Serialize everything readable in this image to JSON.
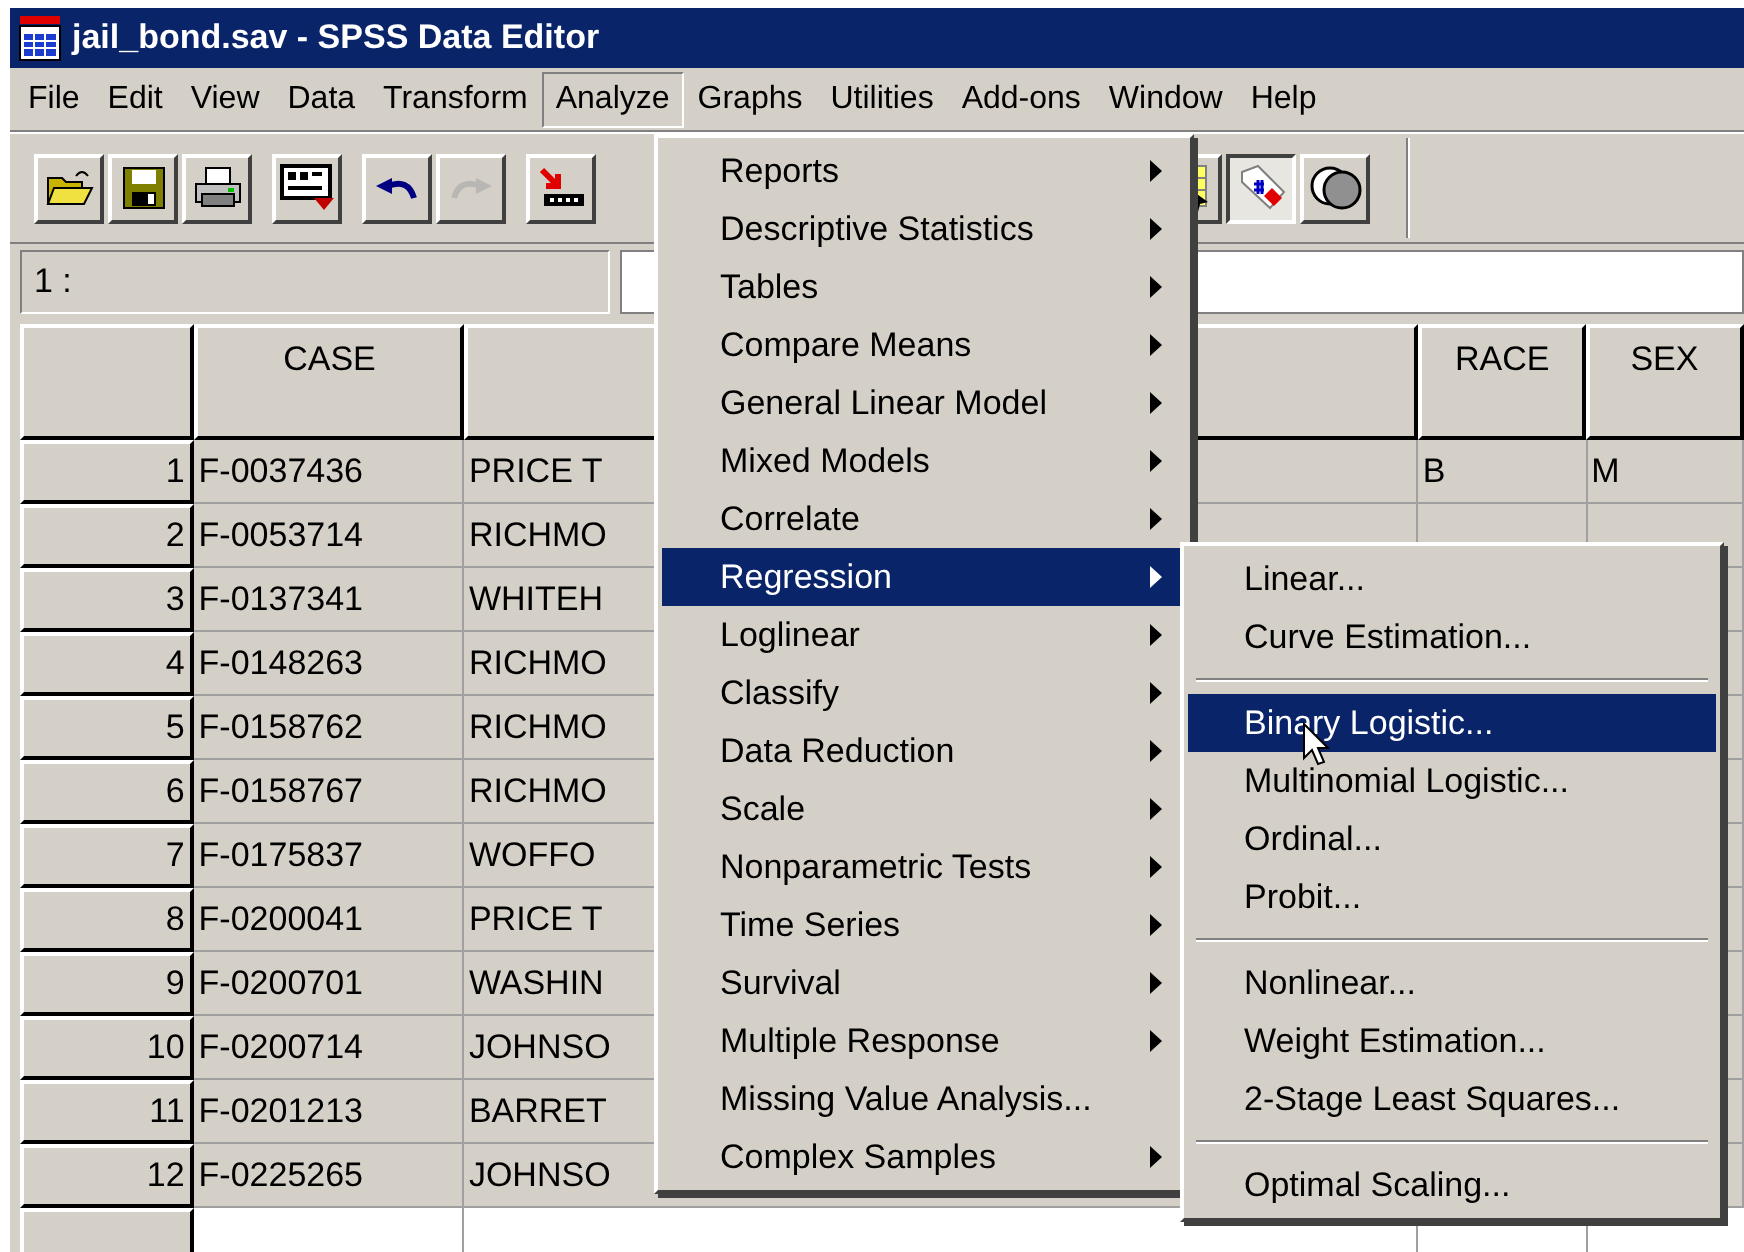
{
  "window": {
    "title": "jail_bond.sav - SPSS Data Editor"
  },
  "menu_bar": [
    {
      "label": "File",
      "selected": false
    },
    {
      "label": "Edit",
      "selected": false
    },
    {
      "label": "View",
      "selected": false
    },
    {
      "label": "Data",
      "selected": false
    },
    {
      "label": "Transform",
      "selected": false
    },
    {
      "label": "Analyze",
      "selected": true
    },
    {
      "label": "Graphs",
      "selected": false
    },
    {
      "label": "Utilities",
      "selected": false
    },
    {
      "label": "Add-ons",
      "selected": false
    },
    {
      "label": "Window",
      "selected": false
    },
    {
      "label": "Help",
      "selected": false
    }
  ],
  "toolbar_left": [
    {
      "kind": "open",
      "disabled": false,
      "pressed": false
    },
    {
      "kind": "save",
      "disabled": false,
      "pressed": false
    },
    {
      "kind": "print",
      "disabled": false,
      "pressed": false
    },
    {
      "kind": "dialog",
      "disabled": false,
      "pressed": false
    },
    {
      "kind": "undo",
      "disabled": false,
      "pressed": false
    },
    {
      "kind": "redo",
      "disabled": true,
      "pressed": false
    },
    {
      "kind": "goto",
      "disabled": false,
      "pressed": false
    }
  ],
  "toolbar_right": [
    {
      "kind": "grid",
      "disabled": false,
      "pressed": false
    },
    {
      "kind": "labels",
      "disabled": false,
      "pressed": true
    },
    {
      "kind": "sets",
      "disabled": false,
      "pressed": false
    }
  ],
  "cell_editor": {
    "cell_ref": "1 :"
  },
  "grid": {
    "columns": {
      "case": "CASE",
      "race": "RACE",
      "sex": "SEX"
    },
    "rows": [
      {
        "number": "1",
        "case": "F-0037436",
        "name": "PRICE T",
        "race": "B",
        "sex": "M"
      },
      {
        "number": "2",
        "case": "F-0053714",
        "name": "RICHMO"
      },
      {
        "number": "3",
        "case": "F-0137341",
        "name": "WHITEH"
      },
      {
        "number": "4",
        "case": "F-0148263",
        "name": "RICHMO"
      },
      {
        "number": "5",
        "case": "F-0158762",
        "name": "RICHMO"
      },
      {
        "number": "6",
        "case": "F-0158767",
        "name": "RICHMO"
      },
      {
        "number": "7",
        "case": "F-0175837",
        "name": "WOFFO"
      },
      {
        "number": "8",
        "case": "F-0200041",
        "name": "PRICE T"
      },
      {
        "number": "9",
        "case": "F-0200701",
        "name": "WASHIN"
      },
      {
        "number": "10",
        "case": "F-0200714",
        "name": "JOHNSO"
      },
      {
        "number": "11",
        "case": "F-0201213",
        "name": "BARRET"
      },
      {
        "number": "12",
        "case": "F-0225265",
        "name": "JOHNSO"
      }
    ]
  },
  "analyze_menu": [
    {
      "label": "Reports",
      "submenu": true,
      "selected": false
    },
    {
      "label": "Descriptive Statistics",
      "submenu": true,
      "selected": false
    },
    {
      "label": "Tables",
      "submenu": true,
      "selected": false
    },
    {
      "label": "Compare Means",
      "submenu": true,
      "selected": false
    },
    {
      "label": "General Linear Model",
      "submenu": true,
      "selected": false
    },
    {
      "label": "Mixed Models",
      "submenu": true,
      "selected": false
    },
    {
      "label": "Correlate",
      "submenu": true,
      "selected": false
    },
    {
      "label": "Regression",
      "submenu": true,
      "selected": true
    },
    {
      "label": "Loglinear",
      "submenu": true,
      "selected": false
    },
    {
      "label": "Classify",
      "submenu": true,
      "selected": false
    },
    {
      "label": "Data Reduction",
      "submenu": true,
      "selected": false
    },
    {
      "label": "Scale",
      "submenu": true,
      "selected": false
    },
    {
      "label": "Nonparametric Tests",
      "submenu": true,
      "selected": false
    },
    {
      "label": "Time Series",
      "submenu": true,
      "selected": false
    },
    {
      "label": "Survival",
      "submenu": true,
      "selected": false
    },
    {
      "label": "Multiple Response",
      "submenu": true,
      "selected": false
    },
    {
      "label": "Missing Value Analysis...",
      "submenu": false,
      "selected": false
    },
    {
      "label": "Complex Samples",
      "submenu": true,
      "selected": false
    }
  ],
  "regression_submenu": [
    [
      {
        "label": "Linear...",
        "selected": false
      },
      {
        "label": "Curve Estimation...",
        "selected": false
      }
    ],
    [
      {
        "label": "Binary Logistic...",
        "selected": true
      },
      {
        "label": "Multinomial Logistic...",
        "selected": false
      },
      {
        "label": "Ordinal...",
        "selected": false
      },
      {
        "label": "Probit...",
        "selected": false
      }
    ],
    [
      {
        "label": "Nonlinear...",
        "selected": false
      },
      {
        "label": "Weight Estimation...",
        "selected": false
      },
      {
        "label": "2-Stage Least Squares...",
        "selected": false
      }
    ],
    [
      {
        "label": "Optimal Scaling...",
        "selected": false
      }
    ]
  ]
}
